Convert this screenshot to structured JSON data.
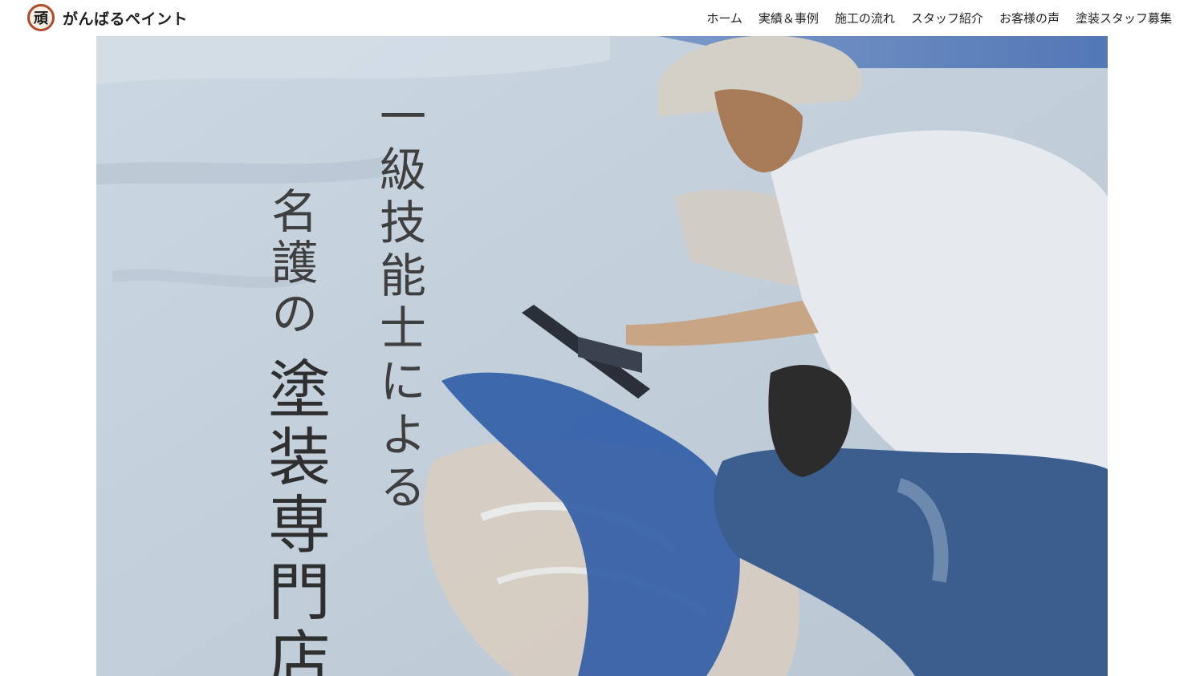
{
  "site": {
    "logo_mark": "頑",
    "name": "がんばるペイント"
  },
  "nav": {
    "items": [
      {
        "label": "ホーム"
      },
      {
        "label": "実績＆事例"
      },
      {
        "label": "施工の流れ"
      },
      {
        "label": "スタッフ紹介"
      },
      {
        "label": "お客様の声"
      },
      {
        "label": "塗装スタッフ募集"
      }
    ]
  },
  "hero": {
    "catch_line1": "一級技能士による",
    "catch_line2": "名護の",
    "catch_line3": "塗装専門店"
  }
}
